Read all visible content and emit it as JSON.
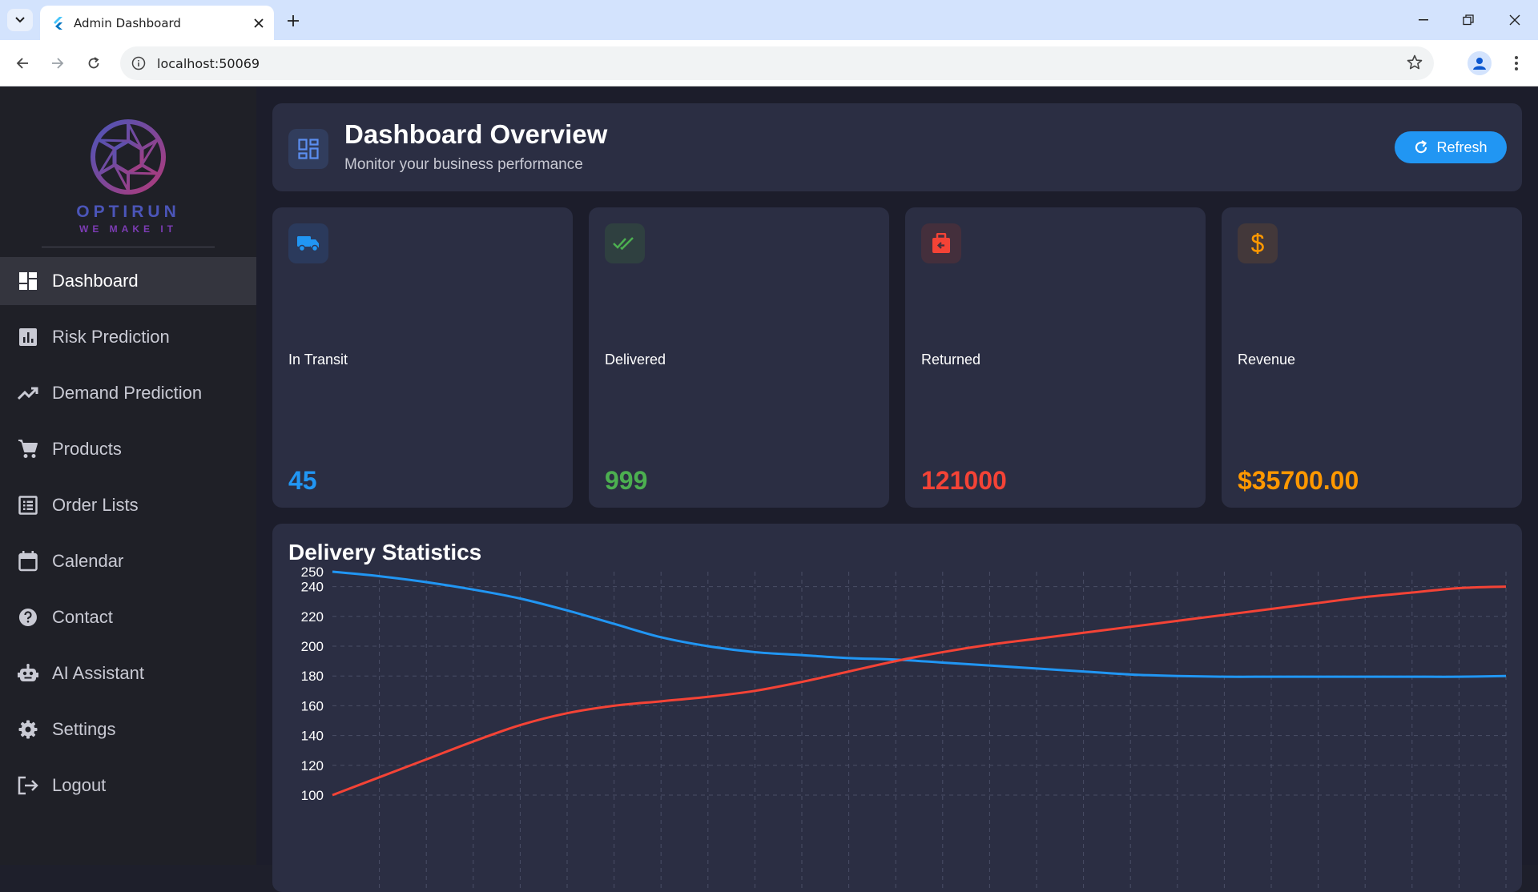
{
  "browser": {
    "tab_title": "Admin Dashboard",
    "url": "localhost:50069"
  },
  "brand": {
    "name": "OPTIRUN",
    "tagline": "WE MAKE IT"
  },
  "sidebar": {
    "items": [
      {
        "label": "Dashboard",
        "icon": "dashboard-icon",
        "active": true
      },
      {
        "label": "Risk Prediction",
        "icon": "bar-chart-icon",
        "active": false
      },
      {
        "label": "Demand Prediction",
        "icon": "trending-up-icon",
        "active": false
      },
      {
        "label": "Products",
        "icon": "cart-icon",
        "active": false
      },
      {
        "label": "Order Lists",
        "icon": "list-icon",
        "active": false
      },
      {
        "label": "Calendar",
        "icon": "calendar-icon",
        "active": false
      },
      {
        "label": "Contact",
        "icon": "help-icon",
        "active": false
      },
      {
        "label": "AI Assistant",
        "icon": "robot-icon",
        "active": false
      },
      {
        "label": "Settings",
        "icon": "gear-icon",
        "active": false
      },
      {
        "label": "Logout",
        "icon": "logout-icon",
        "active": false
      }
    ]
  },
  "header": {
    "title": "Dashboard Overview",
    "subtitle": "Monitor your business performance",
    "refresh_label": "Refresh"
  },
  "stats": [
    {
      "label": "In Transit",
      "value": "45",
      "color": "#2196f3",
      "icon": "truck-icon"
    },
    {
      "label": "Delivered",
      "value": "999",
      "color": "#4caf50",
      "icon": "double-check-icon"
    },
    {
      "label": "Returned",
      "value": "121000",
      "color": "#f44336",
      "icon": "return-box-icon"
    },
    {
      "label": "Revenue",
      "value": "$35700.00",
      "color": "#ff9800",
      "icon": "dollar-icon"
    }
  ],
  "chart": {
    "title": "Delivery Statistics"
  },
  "chart_data": {
    "type": "line",
    "title": "Delivery Statistics",
    "ylim": [
      100,
      250
    ],
    "yticks": [
      100,
      120,
      140,
      160,
      180,
      200,
      220,
      240,
      250
    ],
    "grid": true,
    "x": [
      0,
      1,
      2,
      3,
      4,
      5,
      6,
      7,
      8,
      9,
      10,
      11,
      12,
      13,
      14,
      15,
      16,
      17,
      18,
      19,
      20,
      21,
      22,
      23,
      24,
      25
    ],
    "series": [
      {
        "color": "#2196f3",
        "values": [
          250,
          247,
          243,
          238,
          232,
          224,
          215,
          206,
          200,
          196,
          194,
          192,
          191,
          189,
          187,
          185,
          183,
          181,
          180,
          179.5,
          179.5,
          179.5,
          179.5,
          179.5,
          179.5,
          180
        ]
      },
      {
        "color": "#f44336",
        "values": [
          100,
          112,
          124,
          136,
          147,
          155,
          160,
          163,
          166,
          170,
          176,
          183,
          190,
          196,
          201,
          205,
          209,
          213,
          217,
          221,
          225,
          229,
          233,
          236,
          239,
          240
        ]
      }
    ]
  }
}
